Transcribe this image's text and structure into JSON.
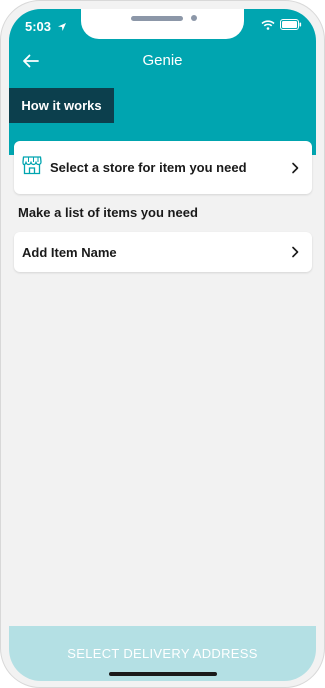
{
  "status_bar": {
    "time": "5:03"
  },
  "header": {
    "title": "Genie",
    "how_it_works": "How it works"
  },
  "store_card": {
    "label": "Select a store for item you need"
  },
  "section": {
    "label": "Make a list of items you need"
  },
  "item_card": {
    "label": "Add Item Name"
  },
  "footer": {
    "button_label": "SELECT DELIVERY ADDRESS"
  },
  "colors": {
    "primary": "#00a5b0",
    "dark": "#0c3f4d",
    "footer_disabled": "#b4e0e4",
    "background": "#f2f2f2"
  }
}
